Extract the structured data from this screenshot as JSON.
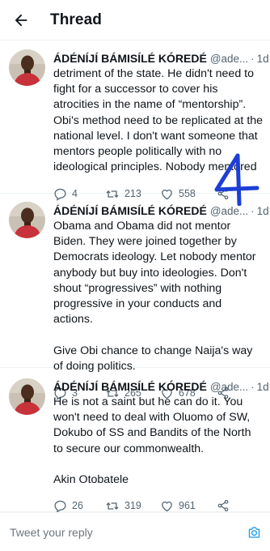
{
  "header": {
    "title": "Thread",
    "back_icon": "arrow-left-icon"
  },
  "tweets": [
    {
      "author": "ÁDÉNÍJÍ BÁMISÍLÉ KÓREDÉ",
      "handle": "@ade...",
      "separator": "·",
      "time": "1d",
      "text": "detriment of the state. He didn't need to fight for a successor to cover his atrocities in the name of “mentorship”. Obi's method need to be replicated at the national level. I don't want someone that mentors people politically with no ideological principles. Nobody mentored",
      "replies": "4",
      "retweets": "213",
      "likes": "558"
    },
    {
      "author": "ÁDÉNÍJÍ BÁMISÍLÉ KÓREDÉ",
      "handle": "@ade...",
      "separator": "·",
      "time": "1d",
      "text": "Obama and Obama did not mentor Biden. They were joined together by Democrats ideology. Let nobody mentor anybody but buy into ideologies. Don't shout “progressives” with nothing progressive in your conducts and actions.\n\nGive Obi chance to change Naija's way of doing politics.",
      "replies": "3",
      "retweets": "265",
      "likes": "678"
    },
    {
      "author": "ÁDÉNÍJÍ BÁMISÍLÉ KÓREDÉ",
      "handle": "@ade...",
      "separator": "·",
      "time": "1d",
      "text": "He is not a saint but he can do it. You won't need to deal with Oluomo of SW, Dokubo of SS and Bandits of the North to secure our commonwealth.\n\nAkin Otobatele",
      "replies": "26",
      "retweets": "319",
      "likes": "961"
    }
  ],
  "reply_bar": {
    "placeholder": "Tweet your reply",
    "camera_icon": "camera-icon"
  },
  "annotation": {
    "text": "4",
    "color": "#1c3fd6"
  },
  "colors": {
    "accent": "#1d9bf0",
    "muted": "#536471",
    "divider": "#eff3f4"
  }
}
